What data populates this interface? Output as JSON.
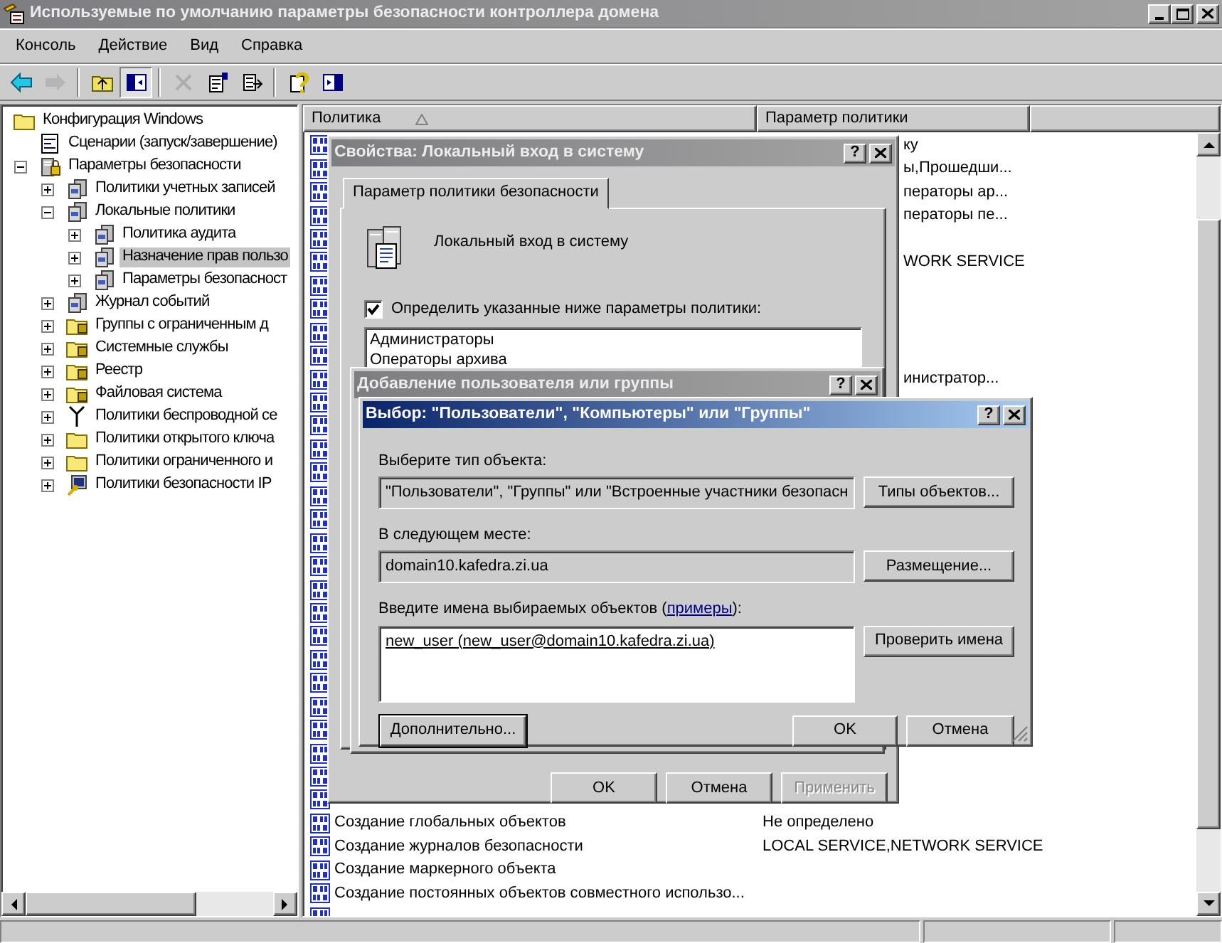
{
  "window": {
    "title": "Используемые по умолчанию параметры безопасности контроллера домена",
    "active": false
  },
  "menu": [
    "Консоль",
    "Действие",
    "Вид",
    "Справка"
  ],
  "toolbar": [
    {
      "kind": "back",
      "disabled": false,
      "pressed": false
    },
    {
      "kind": "forward",
      "disabled": true,
      "pressed": false
    },
    {
      "kind": "separator"
    },
    {
      "kind": "up",
      "disabled": false,
      "pressed": false
    },
    {
      "kind": "tree",
      "disabled": false,
      "pressed": true
    },
    {
      "kind": "separator"
    },
    {
      "kind": "delete",
      "disabled": true,
      "pressed": false
    },
    {
      "kind": "properties",
      "disabled": false,
      "pressed": false
    },
    {
      "kind": "export",
      "disabled": false,
      "pressed": false
    },
    {
      "kind": "separator"
    },
    {
      "kind": "help",
      "disabled": false,
      "pressed": false
    },
    {
      "kind": "action",
      "disabled": false,
      "pressed": false
    }
  ],
  "tree": [
    {
      "label": "Конфигурация Windows",
      "kind": "folder",
      "selected": false,
      "children": [
        {
          "label": "Сценарии (запуск/завершение)",
          "kind": "script",
          "leaf": true,
          "selected": false
        },
        {
          "label": "Параметры безопасности",
          "kind": "secure",
          "expanded": true,
          "selected": false,
          "children": [
            {
              "label": "Политики учетных записей",
              "kind": "servers",
              "expanded": false,
              "selected": false
            },
            {
              "label": "Локальные политики",
              "kind": "servers",
              "expanded": true,
              "selected": false,
              "children": [
                {
                  "label": "Политика аудита",
                  "kind": "servers",
                  "expanded": false,
                  "selected": false
                },
                {
                  "label": "Назначение прав пользо",
                  "kind": "servers",
                  "expanded": false,
                  "selected": true
                },
                {
                  "label": "Параметры безопасност",
                  "kind": "servers",
                  "expanded": false,
                  "selected": false
                }
              ]
            },
            {
              "label": "Журнал событий",
              "kind": "servers",
              "expanded": false,
              "selected": false
            },
            {
              "label": "Группы с ограниченным д",
              "kind": "folder_lock",
              "expanded": false,
              "selected": false
            },
            {
              "label": "Системные службы",
              "kind": "folder_lock",
              "expanded": false,
              "selected": false
            },
            {
              "label": "Реестр",
              "kind": "folder_lock",
              "expanded": false,
              "selected": false
            },
            {
              "label": "Файловая система",
              "kind": "folder_lock",
              "expanded": false,
              "selected": false
            },
            {
              "label": "Политики беспроводной се",
              "kind": "antenna",
              "expanded": false,
              "selected": false
            },
            {
              "label": "Политики открытого ключа",
              "kind": "folder",
              "expanded": false,
              "selected": false
            },
            {
              "label": "Политики ограниченного и",
              "kind": "folder",
              "expanded": false,
              "selected": false
            },
            {
              "label": "Политики безопасности IP",
              "kind": "ip",
              "expanded": false,
              "selected": false
            }
          ]
        }
      ]
    }
  ],
  "list": {
    "columns": [
      "Политика",
      "Параметр политики"
    ],
    "sorted": true,
    "rows": [
      {
        "kind": "policy",
        "setting_tail": "ку"
      },
      {
        "kind": "policy",
        "setting_tail": "ы,Прошедши..."
      },
      {
        "kind": "policy",
        "setting_tail": "ператоры ар..."
      },
      {
        "kind": "policy",
        "setting_tail": "ператоры пе..."
      },
      {
        "kind": "policy"
      },
      {
        "kind": "policy",
        "setting_tail": "WORK SERVICE"
      },
      {
        "kind": "policy"
      },
      {
        "kind": "policy"
      },
      {
        "kind": "policy"
      },
      {
        "kind": "policy"
      },
      {
        "kind": "policy",
        "setting_tail": "инистратор..."
      },
      {
        "kind": "policy"
      },
      {
        "kind": "policy"
      },
      {
        "kind": "policy"
      },
      {
        "kind": "policy"
      },
      {
        "kind": "policy"
      },
      {
        "kind": "policy"
      },
      {
        "kind": "policy"
      },
      {
        "kind": "policy"
      },
      {
        "kind": "policy"
      },
      {
        "kind": "policy"
      },
      {
        "kind": "policy"
      },
      {
        "kind": "policy"
      },
      {
        "kind": "policy"
      },
      {
        "kind": "policy"
      },
      {
        "kind": "policy"
      },
      {
        "kind": "policy"
      },
      {
        "kind": "policy"
      },
      {
        "kind": "policy"
      },
      {
        "kind": "policy",
        "policy": "Создание глобальных объектов",
        "setting": "Не определено"
      },
      {
        "kind": "policy",
        "policy": "Создание журналов безопасности",
        "setting": "LOCAL SERVICE,NETWORK SERVICE"
      },
      {
        "kind": "policy",
        "policy": "Создание маркерного объекта"
      },
      {
        "kind": "policy",
        "policy": "Создание постоянных объектов совместного использо..."
      },
      {
        "kind": "policy"
      }
    ]
  },
  "properties_dialog": {
    "title": "Свойства: Локальный вход в систему",
    "active": false,
    "help": "?",
    "tabs": [
      {
        "label": "Параметр политики безопасности",
        "selected": true
      }
    ],
    "policy_name": "Локальный вход в систему",
    "define": {
      "label": "Определить указанные ниже параметры политики:",
      "checked": true
    },
    "members": [
      "Администраторы",
      "Операторы архива"
    ],
    "buttons": [
      {
        "label": "OK",
        "disabled": false
      },
      {
        "label": "Отмена",
        "disabled": false
      },
      {
        "label": "Применить",
        "disabled": true
      }
    ]
  },
  "add_dialog": {
    "title": "Добавление пользователя или группы",
    "active": false,
    "help": "?"
  },
  "select_dialog": {
    "title": "Выбор: \"Пользователи\", \"Компьютеры\" или \"Группы\"",
    "active": true,
    "help": "?",
    "object_type": {
      "label": "Выберите тип объекта:",
      "value": "\"Пользователи\", \"Группы\" или \"Встроенные участники безопасн",
      "button": "Типы объектов..."
    },
    "location": {
      "label": "В следующем месте:",
      "value": "domain10.kafedra.zi.ua",
      "button": "Размещение..."
    },
    "names": {
      "label_before": "Введите имена выбираемых объектов (",
      "link": "примеры",
      "label_after": "):",
      "value": "new_user (new_user@domain10.kafedra.zi.ua)",
      "button": "Проверить имена"
    },
    "buttons": [
      {
        "label": "Дополнительно...",
        "default": true
      },
      {
        "label": "OK",
        "default": false
      },
      {
        "label": "Отмена",
        "default": false
      }
    ]
  }
}
